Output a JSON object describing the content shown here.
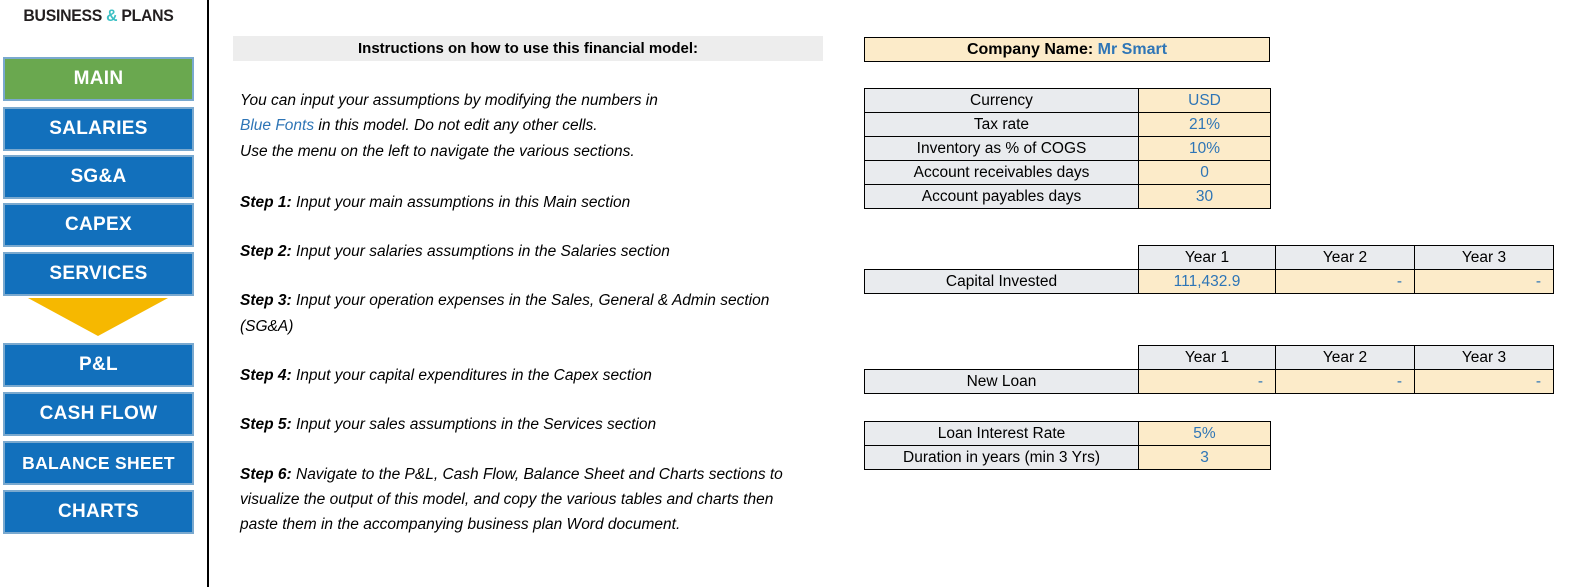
{
  "sidebar": {
    "brand": {
      "prefix": "BUSINESS ",
      "amp": "&",
      "suffix": " PLANS"
    },
    "items": [
      {
        "label": "MAIN",
        "active": true
      },
      {
        "label": "SALARIES",
        "active": false
      },
      {
        "label": "SG&A",
        "active": false
      },
      {
        "label": "CAPEX",
        "active": false
      },
      {
        "label": "SERVICES",
        "active": false
      },
      {
        "label": "P&L",
        "active": false
      },
      {
        "label": "CASH FLOW",
        "active": false
      },
      {
        "label": "BALANCE SHEET",
        "active": false
      },
      {
        "label": "CHARTS",
        "active": false
      }
    ],
    "divider_icon": "down-arrow-icon"
  },
  "instructions": {
    "header": "Instructions on how to use this financial model:",
    "intro_line1": "You can input your assumptions by modifying the numbers in",
    "intro_blue": "Blue Fonts",
    "intro_line2_rest": " in this model. Do not edit any other cells.",
    "intro_line3": "Use the menu on the left to navigate the various sections.",
    "steps": [
      {
        "label": "Step 1:",
        "text": " Input your main assumptions in this Main section"
      },
      {
        "label": "Step 2:",
        "text": " Input your salaries assumptions in the Salaries section"
      },
      {
        "label": "Step 3:",
        "text": " Input your operation expenses in the Sales, General & Admin section (SG&A)"
      },
      {
        "label": "Step 4:",
        "text": " Input your capital expenditures in the Capex section"
      },
      {
        "label": "Step 5:",
        "text": " Input your sales assumptions in the Services section"
      },
      {
        "label": "Step 6:",
        "text": " Navigate to the P&L, Cash Flow, Balance Sheet and Charts sections to visualize the output of this model, and copy the various tables and charts then paste them in the accompanying business plan Word document."
      }
    ]
  },
  "company": {
    "label": "Company Name:",
    "name": "Mr Smart"
  },
  "assumptions": {
    "rows": [
      {
        "label": "Currency",
        "value": "USD"
      },
      {
        "label": "Tax rate",
        "value": "21%"
      },
      {
        "label": "Inventory as % of COGS",
        "value": "10%"
      },
      {
        "label": "Account receivables days",
        "value": "0"
      },
      {
        "label": "Account payables days",
        "value": "30"
      }
    ]
  },
  "capital": {
    "years": [
      "Year 1",
      "Year 2",
      "Year 3"
    ],
    "row_label": "Capital Invested",
    "values": [
      "111,432.9",
      "-",
      "-"
    ]
  },
  "loan": {
    "years": [
      "Year 1",
      "Year 2",
      "Year 3"
    ],
    "row_label": "New Loan",
    "values": [
      "-",
      "-",
      "-"
    ]
  },
  "loan_terms": {
    "rows": [
      {
        "label": "Loan Interest Rate",
        "value": "5%"
      },
      {
        "label": "Duration in years (min 3 Yrs)",
        "value": "3"
      }
    ]
  },
  "colors": {
    "nav_blue": "#1270bc",
    "nav_active_green": "#6aa84f",
    "arrow_yellow": "#f6b800",
    "input_blue_text": "#2e75b6",
    "input_cell_bg": "#fcebc9",
    "label_cell_bg": "#e9ebee",
    "brand_teal": "#3cc0c4"
  }
}
